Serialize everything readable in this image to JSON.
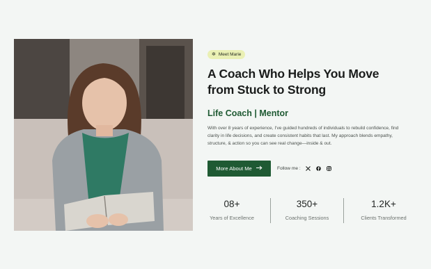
{
  "badge": {
    "icon": "gear-icon",
    "label": "Meet Marie"
  },
  "headline": {
    "line1": "A Coach Who Helps You Move",
    "line2": "from Stuck to Strong"
  },
  "role": "Life Coach | Mentor",
  "description": "With over 8 years of experience, I've guided hundreds of individuals to rebuild confidence, find clarity in life decisions, and create consistent habits that last. My approach blends empathy, structure, & action so you can see real change—inside & out.",
  "cta": {
    "label": "More About Me",
    "icon": "arrow-right-icon"
  },
  "follow": {
    "label": "Follow me :",
    "links": [
      {
        "name": "x-icon"
      },
      {
        "name": "facebook-icon"
      },
      {
        "name": "instagram-icon"
      }
    ]
  },
  "stats": [
    {
      "value": "08+",
      "label": "Years of Excellence"
    },
    {
      "value": "350+",
      "label": "Coaching Sessions"
    },
    {
      "value": "1.2K+",
      "label": "Clients Transformed"
    }
  ],
  "colors": {
    "accent": "#1f5a33",
    "badge_bg": "#eaf0b4",
    "page_bg": "#f3f6f4"
  }
}
